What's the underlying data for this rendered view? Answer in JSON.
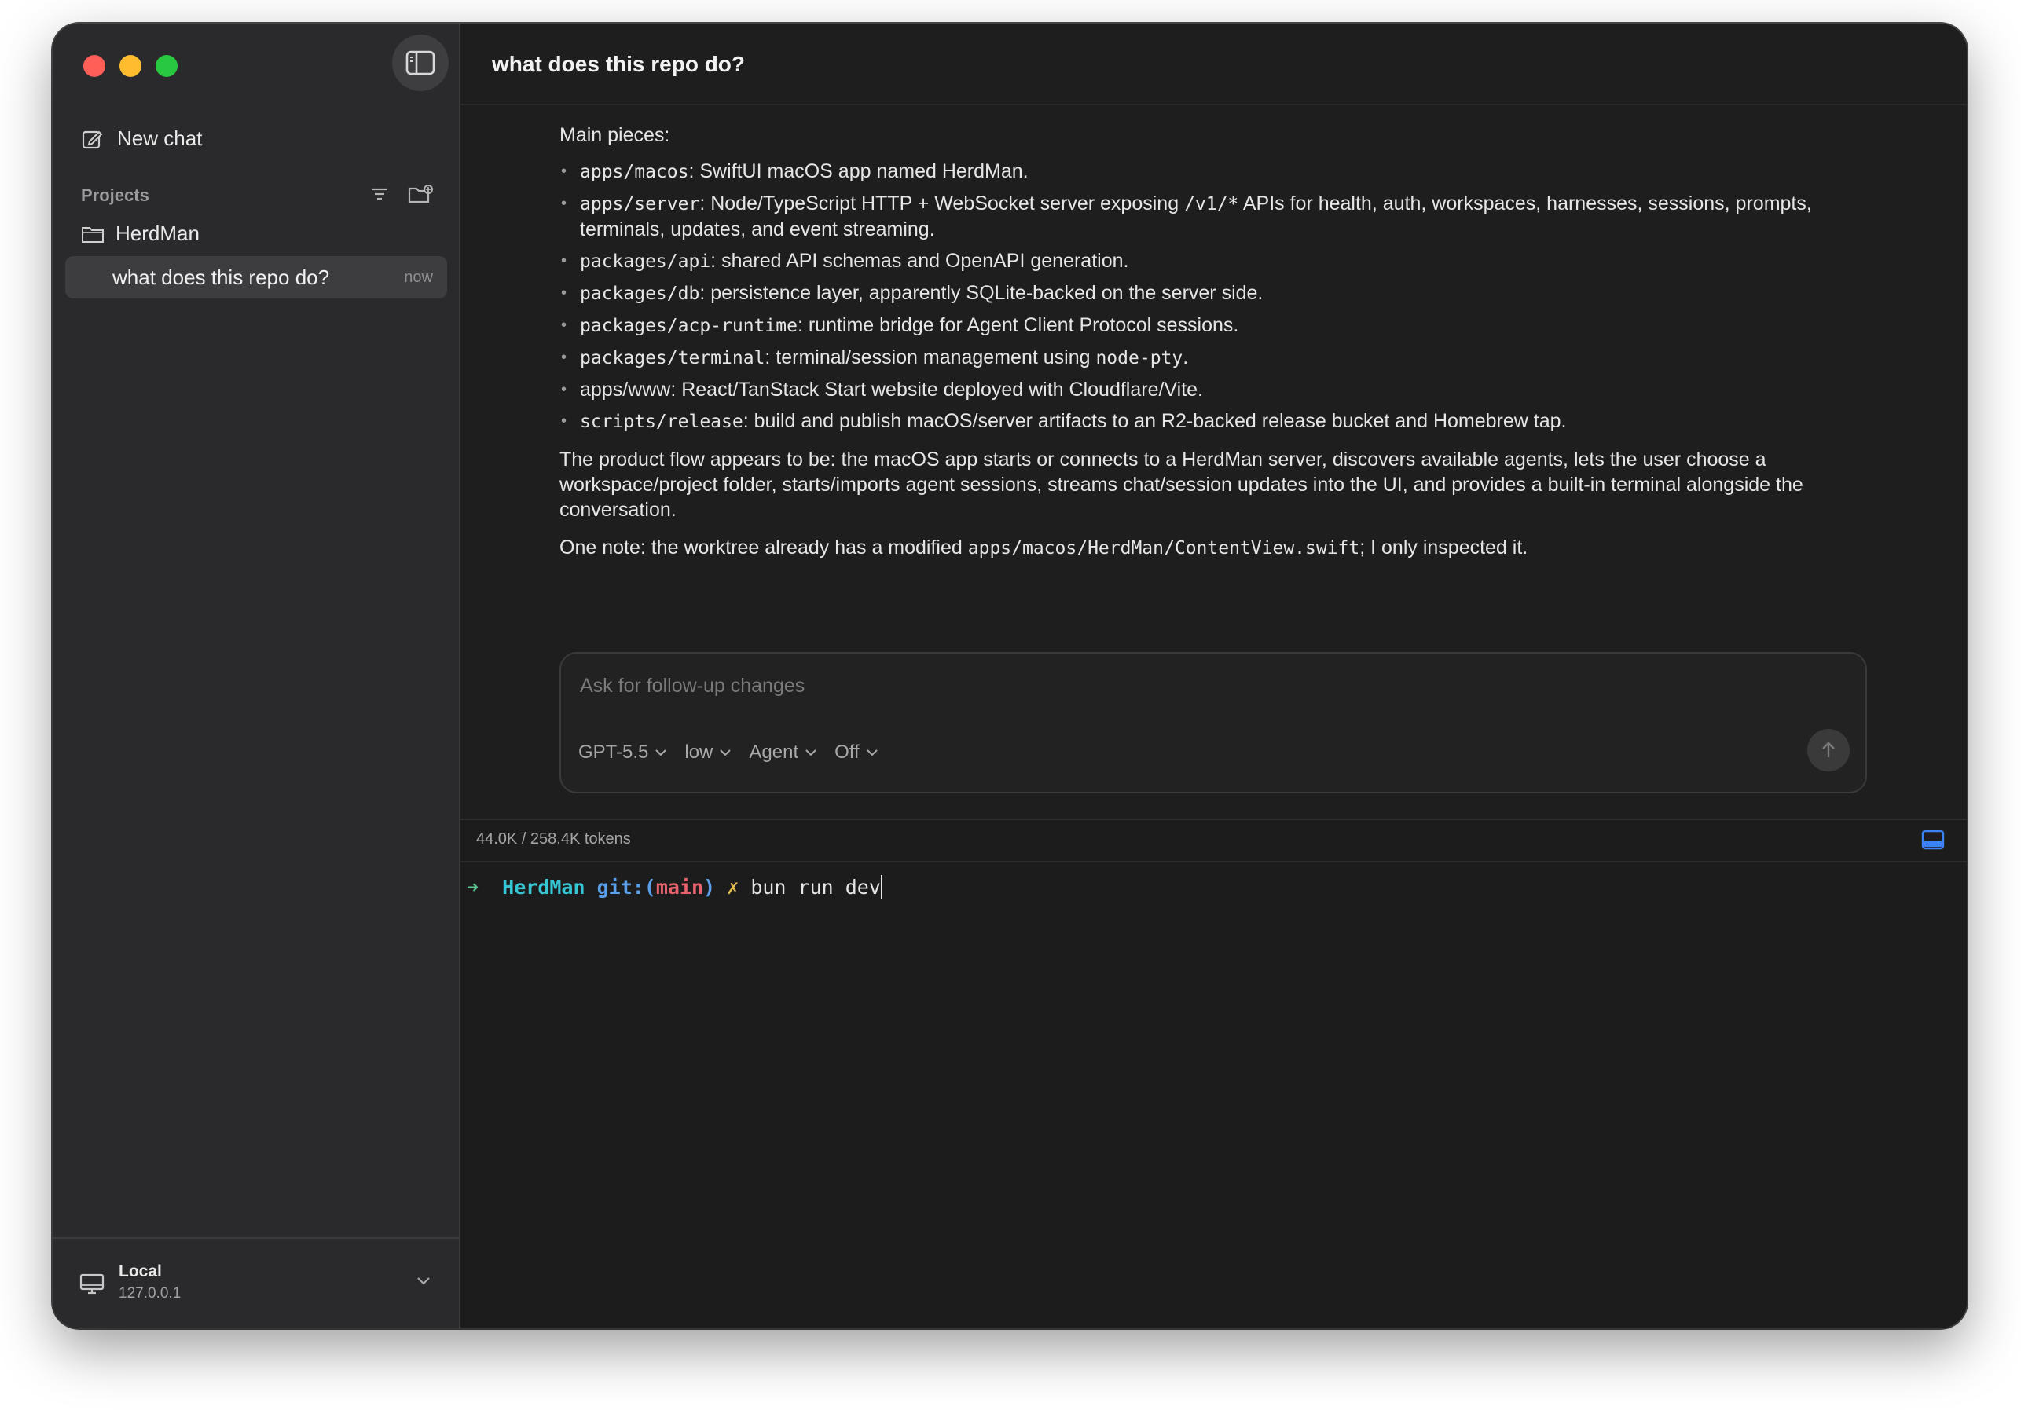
{
  "window": {
    "title": "what does this repo do?"
  },
  "sidebar": {
    "new_chat_label": "New chat",
    "projects_label": "Projects",
    "project_name": "HerdMan",
    "chat_item": {
      "title": "what does this repo do?",
      "time": "now"
    },
    "footer": {
      "name": "Local",
      "address": "127.0.0.1"
    }
  },
  "transcript": {
    "heading": "Main pieces:",
    "items": [
      {
        "code": "apps/macos",
        "text": ": SwiftUI macOS app named HerdMan."
      },
      {
        "code": "apps/server",
        "text": ": Node/TypeScript HTTP + WebSocket server exposing ",
        "code2": "/v1/*",
        "text2": " APIs for health, auth, workspaces, harnesses, sessions, prompts, terminals, updates, and event streaming."
      },
      {
        "code": "packages/api",
        "text": ": shared API schemas and OpenAPI generation."
      },
      {
        "code": "packages/db",
        "text": ": persistence layer, apparently SQLite-backed on the server side."
      },
      {
        "code": "packages/acp-runtime",
        "text": ": runtime bridge for Agent Client Protocol sessions."
      },
      {
        "code": "packages/terminal",
        "text": ": terminal/session management using ",
        "code2": "node-pty",
        "text2": "."
      },
      {
        "code": "",
        "text": "apps/www: React/TanStack Start website deployed with Cloudflare/Vite."
      },
      {
        "code": "scripts/release",
        "text": ": build and publish macOS/server artifacts to an R2-backed release bucket and Homebrew tap."
      }
    ],
    "flow": "The product flow appears to be: the macOS app starts or connects to a HerdMan server, discovers available agents, lets the user choose a workspace/project folder, starts/imports agent sessions, streams chat/session updates into the UI, and provides a built-in terminal alongside the conversation.",
    "note_prefix": "One note: the worktree already has a modified ",
    "note_code": "apps/macos/HerdMan/ContentView.swift",
    "note_suffix": "; I only inspected it."
  },
  "composer": {
    "placeholder": "Ask for follow-up changes",
    "model": "GPT-5.5",
    "effort": "low",
    "mode": "Agent",
    "toggle": "Off"
  },
  "terminal": {
    "tokens": "44.0K / 258.4K tokens",
    "prompt_arrow": "➜",
    "dir": "HerdMan",
    "git_label": "git:(",
    "branch": "main",
    "git_close": ")",
    "dirty_mark": "✗",
    "command": "bun run dev"
  },
  "colors": {
    "close": "#ff5f57",
    "minimize": "#febc2e",
    "zoom": "#28c840",
    "prompt_dir": "#36c6d3",
    "branch": "#e8636d",
    "panel_icon": "#3b82f6"
  },
  "icons": [
    "sidebar-toggle-icon",
    "compose-icon",
    "filter-icon",
    "new-folder-icon",
    "folder-icon",
    "monitor-icon",
    "chevron-down-icon",
    "arrow-up-icon",
    "terminal-panel-icon"
  ]
}
